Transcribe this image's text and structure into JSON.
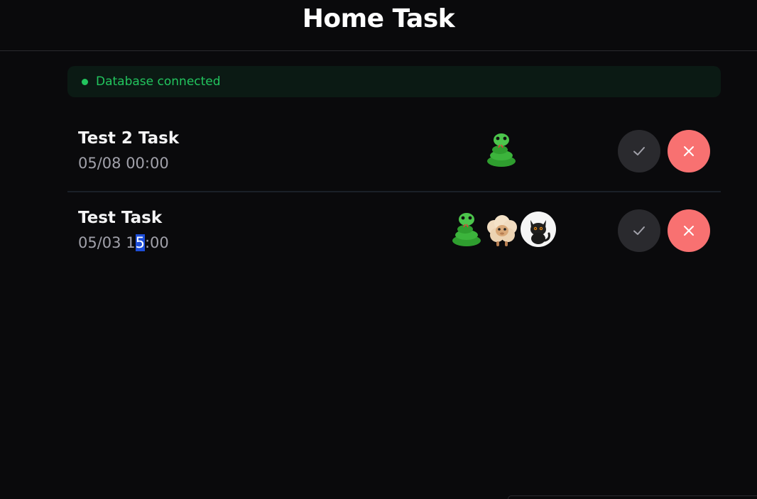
{
  "header": {
    "title": "Home Task"
  },
  "status": {
    "text": "Database connected",
    "color": "#22c55e"
  },
  "tasks": [
    {
      "title": "Test 2 Task",
      "time": "05/08 00:00",
      "assignees": [
        "snake-icon"
      ]
    },
    {
      "title": "Test Task",
      "time_before": "05/03 1",
      "time_selected": "5",
      "time_after": ":00",
      "assignees": [
        "snake-icon",
        "sheep-icon",
        "black-cat-icon"
      ]
    }
  ],
  "colors": {
    "background": "#0a0a0c",
    "check_button": "#2a2a2e",
    "delete_button": "#f87171",
    "selection": "#1d4ed8"
  }
}
